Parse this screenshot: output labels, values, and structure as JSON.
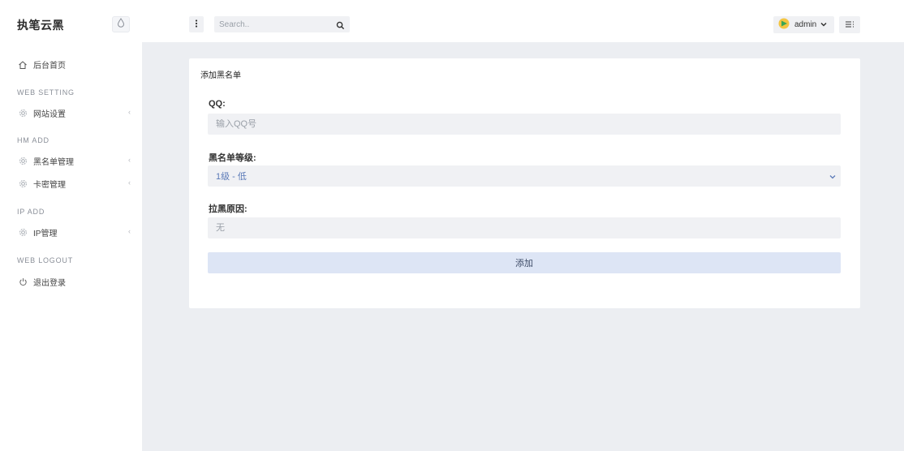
{
  "brand": {
    "title": "执笔云黑",
    "icon": "droplet-icon"
  },
  "sidebar": {
    "home": {
      "label": "后台首页",
      "icon": "home-icon"
    },
    "sections": [
      {
        "title": "WEB SETTING",
        "items": [
          {
            "label": "网站设置",
            "icon": "gear-icon"
          }
        ]
      },
      {
        "title": "HM ADD",
        "items": [
          {
            "label": "黑名单管理",
            "icon": "gear-icon"
          },
          {
            "label": "卡密管理",
            "icon": "gear-icon"
          }
        ]
      },
      {
        "title": "IP ADD",
        "items": [
          {
            "label": "IP管理",
            "icon": "gear-icon"
          }
        ]
      },
      {
        "title": "WEB LOGOUT",
        "items": [
          {
            "label": "退出登录",
            "icon": "power-icon"
          }
        ]
      }
    ]
  },
  "header": {
    "search_placeholder": "Search..",
    "user": {
      "name": "admin"
    }
  },
  "form": {
    "title": "添加黑名单",
    "qq_label": "QQ:",
    "qq_placeholder": "输入QQ号",
    "level_label": "黑名单等级:",
    "level_value": "1级 - 低",
    "reason_label": "拉黑原因:",
    "reason_placeholder": "无",
    "submit_label": "添加"
  },
  "colors": {
    "main_bg": "#eceef2",
    "field_bg": "#f0f1f4",
    "button_bg": "#dde5f5",
    "select_text": "#5b7ab8"
  }
}
